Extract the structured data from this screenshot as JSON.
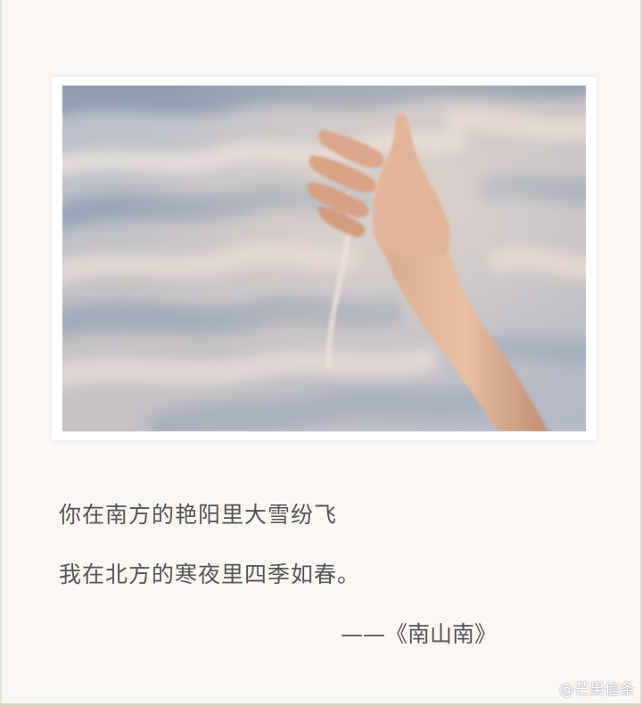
{
  "poem": {
    "line1": "你在南方的艳阳里大雪纷飞",
    "line2": "我在北方的寒夜里四季如春。",
    "attribution": "——《南山南》"
  },
  "watermark": "@芒果信条",
  "photo": {
    "subject": "hand-pouring-sand"
  },
  "colors": {
    "background": "#fbf7f5",
    "text": "#555555",
    "frame": "#ffffff"
  }
}
